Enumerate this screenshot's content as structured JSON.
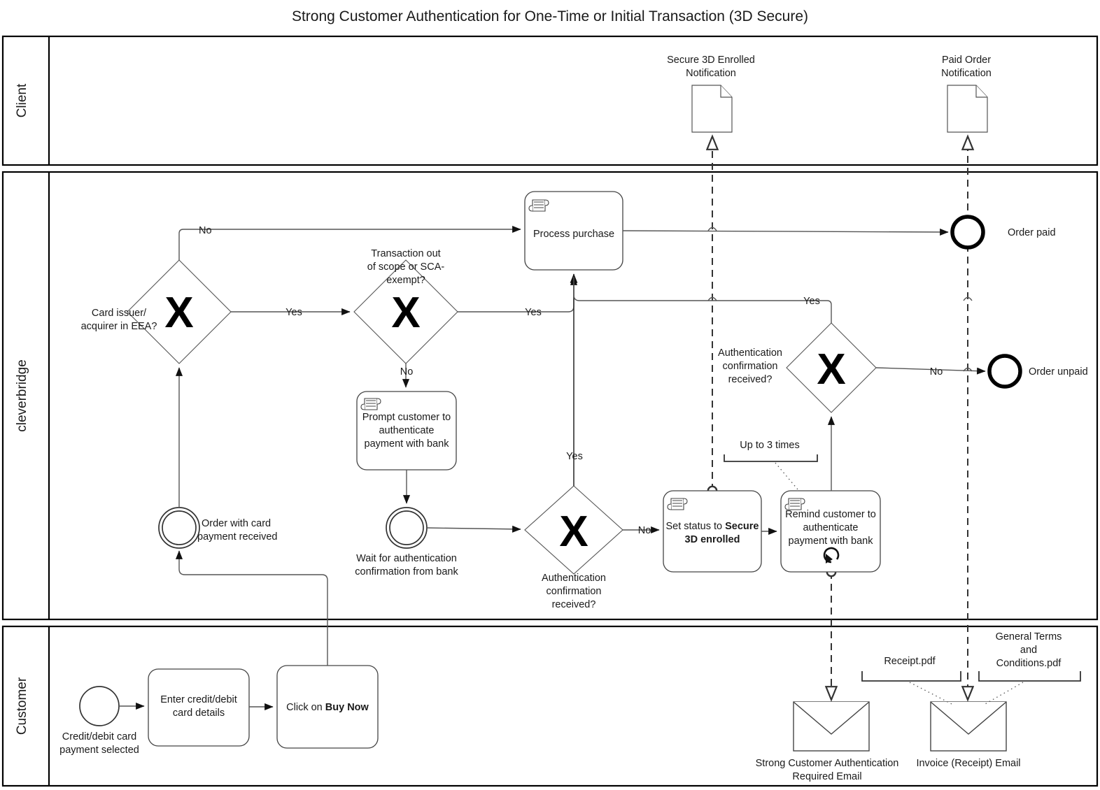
{
  "title": "Strong Customer Authentication for One-Time or Initial Transaction (3D Secure)",
  "lanes": [
    {
      "id": "client",
      "label": "Client"
    },
    {
      "id": "cleverbridge",
      "label": "cleverbridge"
    },
    {
      "id": "customer",
      "label": "Customer"
    }
  ],
  "client_lane": {
    "notifications": [
      {
        "id": "secure3d",
        "line1": "Secure 3D Enrolled",
        "line2": "Notification",
        "icon": "document-icon"
      },
      {
        "id": "paidorder",
        "line1": "Paid Order",
        "line2": "Notification",
        "icon": "document-icon"
      }
    ]
  },
  "cleverbridge_lane": {
    "gateways": [
      {
        "id": "eea",
        "symbol": "X",
        "label_lines": [
          "Card issuer/",
          "acquirer in EEA?"
        ]
      },
      {
        "id": "scope",
        "symbol": "X",
        "label_lines": [
          "Transaction out",
          "of scope or SCA-",
          "exempt?"
        ]
      },
      {
        "id": "auth1",
        "symbol": "X",
        "label_lines": [
          "Authentication",
          "confirmation",
          "received?"
        ]
      },
      {
        "id": "auth2",
        "symbol": "X",
        "label_lines": [
          "Authentication",
          "confirmation",
          "received?"
        ]
      }
    ],
    "tasks": [
      {
        "id": "process",
        "lines": [
          {
            "text": "Process purchase",
            "bold": false
          }
        ],
        "icon": "script-task-icon",
        "loop": false
      },
      {
        "id": "prompt",
        "lines": [
          {
            "text": "Prompt customer to",
            "bold": false
          },
          {
            "text": "authenticate",
            "bold": false
          },
          {
            "text": "payment with bank",
            "bold": false
          }
        ],
        "icon": "script-task-icon",
        "loop": false
      },
      {
        "id": "setstatus",
        "lines": [
          {
            "text": "Set status to ",
            "bold": false
          },
          {
            "text": "Secure",
            "bold": true
          },
          {
            "text": "3D enrolled",
            "bold": true
          }
        ],
        "icon": "script-task-icon",
        "loop": false
      },
      {
        "id": "remind",
        "lines": [
          {
            "text": "Remind customer to",
            "bold": false
          },
          {
            "text": "authenticate",
            "bold": false
          },
          {
            "text": "payment with bank",
            "bold": false
          }
        ],
        "icon": "script-task-icon",
        "loop": true
      }
    ],
    "events": [
      {
        "id": "order-received",
        "type": "intermediate",
        "label_lines": [
          "Order with card",
          "payment received"
        ]
      },
      {
        "id": "wait-auth",
        "type": "intermediate",
        "label_lines": [
          "Wait for authentication",
          "confirmation from bank"
        ]
      },
      {
        "id": "order-paid",
        "type": "end",
        "label_lines": [
          "Order paid"
        ]
      },
      {
        "id": "order-unpaid",
        "type": "end",
        "label_lines": [
          "Order unpaid"
        ]
      }
    ],
    "annotations": [
      {
        "id": "up-to-3-times",
        "text": "Up to 3 times"
      }
    ],
    "edge_labels": {
      "eea_no": "No",
      "eea_yes": "Yes",
      "scope_yes": "Yes",
      "scope_no": "No",
      "auth1_yes": "Yes",
      "auth1_no": "No",
      "auth2_yes": "Yes",
      "auth2_no": "No"
    }
  },
  "customer_lane": {
    "start_event": {
      "id": "start",
      "label_lines": [
        "Credit/debit card",
        "payment selected"
      ]
    },
    "tasks": [
      {
        "id": "enter-card",
        "lines": [
          {
            "text": "Enter credit/debit",
            "bold": false
          },
          {
            "text": "card details",
            "bold": false
          }
        ]
      },
      {
        "id": "click-buy",
        "lines": [
          {
            "text": "Click on ",
            "bold": false
          },
          {
            "text": "Buy Now",
            "bold": true
          }
        ]
      }
    ],
    "emails": [
      {
        "id": "sca-email",
        "label_lines": [
          "Strong Customer Authentication",
          "Required Email"
        ],
        "icon": "envelope-icon"
      },
      {
        "id": "invoice-email",
        "label_lines": [
          "Invoice (Receipt) Email"
        ],
        "icon": "envelope-icon"
      }
    ],
    "attachments": [
      {
        "id": "receipt",
        "text": "Receipt.pdf"
      },
      {
        "id": "gtc",
        "lines": [
          "General Terms",
          "and",
          "Conditions.pdf"
        ]
      }
    ]
  },
  "colors": {
    "stroke": "#333333",
    "lane_border": "#000000",
    "background": "#ffffff",
    "text": "#1a1a1a"
  }
}
